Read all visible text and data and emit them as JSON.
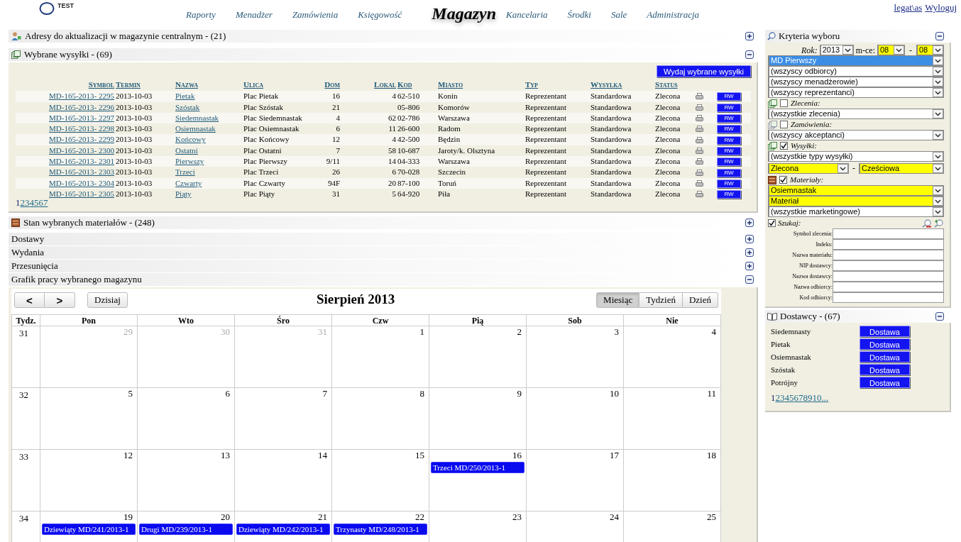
{
  "header": {
    "logo": "TEST",
    "nav": [
      {
        "label": "Raporty",
        "selected": false
      },
      {
        "label": "Menadżer",
        "selected": false
      },
      {
        "label": "Zamówienia",
        "selected": false
      },
      {
        "label": "Księgowość",
        "selected": false
      },
      {
        "label": "Magazyn",
        "selected": true
      },
      {
        "label": "Kancelaria",
        "selected": false
      },
      {
        "label": "Środki",
        "selected": false
      },
      {
        "label": "Sale",
        "selected": false
      },
      {
        "label": "Administracja",
        "selected": false
      }
    ],
    "user": "legat\\as",
    "logout": "Wyloguj"
  },
  "addresses_panel": {
    "title": "Adresy do aktualizacji w magazynie centralnym - (21)",
    "expanded": false
  },
  "shipments_panel": {
    "title": "Wybrane wysyłki - (69)",
    "expanded": true,
    "issue_button": "Wydaj wybrane wysyłki",
    "columns": [
      "Symbol",
      "Termin",
      "Nazwa",
      "Ulica",
      "Dom",
      "Lokal",
      "Kod",
      "Miasto",
      "Typ",
      "Wysylka",
      "Status"
    ],
    "rows": [
      {
        "symbol": "MD-165-2013- 2295",
        "termin": "2013-10-03",
        "nazwa": "Pietak",
        "ulica": "Plac Pietak",
        "dom": "16",
        "lokal": "4",
        "kod": "62-510",
        "miasto": "Konin",
        "typ": "Reprezentant",
        "wysylka": "Standardowa",
        "status": "Zlecona",
        "action": "RW"
      },
      {
        "symbol": "MD-165-2013- 2296",
        "termin": "2013-10-03",
        "nazwa": "Szóstak",
        "ulica": "Plac Szóstak",
        "dom": "21",
        "kod": "05-806",
        "miasto": "Komorów",
        "typ": "Reprezentant",
        "wysylka": "Standardowa",
        "status": "Zlecona",
        "action": "RW"
      },
      {
        "symbol": "MD-165-2013- 2297",
        "termin": "2013-10-03",
        "nazwa": "Siedemnastak",
        "ulica": "Plac Siedemnastak",
        "dom": "4",
        "lokal": "62",
        "kod": "02-786",
        "miasto": "Warszawa",
        "typ": "Reprezentant",
        "wysylka": "Standardowa",
        "status": "Zlecona",
        "action": "RW"
      },
      {
        "symbol": "MD-165-2013- 2298",
        "termin": "2013-10-03",
        "nazwa": "Osiemnastak",
        "ulica": "Plac Osiemnastak",
        "dom": "6",
        "lokal": "11",
        "kod": "26-600",
        "miasto": "Radom",
        "typ": "Reprezentant",
        "wysylka": "Standardowa",
        "status": "Zlecona",
        "action": "RW"
      },
      {
        "symbol": "MD-165-2013- 2299",
        "termin": "2013-10-03",
        "nazwa": "Końcowy",
        "ulica": "Plac Końcowy",
        "dom": "12",
        "lokal": "4",
        "kod": "42-500",
        "miasto": "Będzin",
        "typ": "Reprezentant",
        "wysylka": "Standardowa",
        "status": "Zlecona",
        "action": "RW"
      },
      {
        "symbol": "MD-165-2013- 2300",
        "termin": "2013-10-03",
        "nazwa": "Ostatni",
        "ulica": "Plac Ostatni",
        "dom": "7",
        "lokal": "58",
        "kod": "10-687",
        "miasto": "Jaroty/k. Olsztyna",
        "typ": "Reprezentant",
        "wysylka": "Standardowa",
        "status": "Zlecona",
        "action": "RW"
      },
      {
        "symbol": "MD-165-2013- 2301",
        "termin": "2013-10-03",
        "nazwa": "Pierwszy",
        "ulica": "Plac Pierwszy",
        "dom": "9/11",
        "lokal": "14",
        "kod": "04-333",
        "miasto": "Warszawa",
        "typ": "Reprezentant",
        "wysylka": "Standardowa",
        "status": "Zlecona",
        "action": "RW"
      },
      {
        "symbol": "MD-165-2013- 2303",
        "termin": "2013-10-03",
        "nazwa": "Trzeci",
        "ulica": "Plac Trzeci",
        "dom": "26",
        "lokal": "6",
        "kod": "70-028",
        "miasto": "Szczecin",
        "typ": "Reprezentant",
        "wysylka": "Standardowa",
        "status": "Zlecona",
        "action": "RW"
      },
      {
        "symbol": "MD-165-2013- 2304",
        "termin": "2013-10-03",
        "nazwa": "Czwarty",
        "ulica": "Plac Czwarty",
        "dom": "94F",
        "lokal": "20",
        "kod": "87-100",
        "miasto": "Toruń",
        "typ": "Reprezentant",
        "wysylka": "Standardowa",
        "status": "Zlecona",
        "action": "RW"
      },
      {
        "symbol": "MD-165-2013- 2305",
        "termin": "2013-10-03",
        "nazwa": "Piąty",
        "ulica": "Plac Piąty",
        "dom": "31",
        "lokal": "5",
        "kod": "64-920",
        "miasto": "Piła",
        "typ": "Reprezentant",
        "wysylka": "Standardowa",
        "status": "Zlecona",
        "action": "RW"
      }
    ],
    "pages": [
      {
        "label": "1",
        "selected": true
      },
      {
        "label": "2",
        "selected": false
      },
      {
        "label": "3",
        "selected": false
      },
      {
        "label": "4",
        "selected": false
      },
      {
        "label": "5",
        "selected": false
      },
      {
        "label": "6",
        "selected": false
      },
      {
        "label": "7",
        "selected": false
      }
    ]
  },
  "materials_panel": {
    "title": "Stan wybranych materiałów - (248)",
    "expanded": false
  },
  "panels": [
    {
      "title": "Dostawy",
      "expanded": false
    },
    {
      "title": "Wydania",
      "expanded": false
    },
    {
      "title": "Przesunięcia",
      "expanded": false
    },
    {
      "title": "Grafik pracy wybranego magazynu",
      "expanded": true
    }
  ],
  "calendar": {
    "prev": "<",
    "next": ">",
    "today": "Dzisiaj",
    "title": "Sierpień 2013",
    "views": [
      {
        "label": "Miesiąc",
        "selected": true
      },
      {
        "label": "Tydzień",
        "selected": false
      },
      {
        "label": "Dzień",
        "selected": false
      }
    ],
    "week_header": "Tydz.",
    "day_names": [
      "Pon",
      "Wto",
      "Śro",
      "Czw",
      "Pią",
      "Sob",
      "Nie"
    ],
    "weeks": [
      {
        "number": "31",
        "days": [
          {
            "date": "29",
            "other_month": true
          },
          {
            "date": "30",
            "other_month": true
          },
          {
            "date": "31",
            "other_month": true
          },
          {
            "date": "1",
            "other_month": false
          },
          {
            "date": "2",
            "other_month": false
          },
          {
            "date": "3",
            "other_month": false
          },
          {
            "date": "4",
            "other_month": false
          }
        ]
      },
      {
        "number": "32",
        "days": [
          {
            "date": "5",
            "other_month": false
          },
          {
            "date": "6",
            "other_month": false
          },
          {
            "date": "7",
            "other_month": false
          },
          {
            "date": "8",
            "other_month": false
          },
          {
            "date": "9",
            "other_month": false
          },
          {
            "date": "10",
            "other_month": false
          },
          {
            "date": "11",
            "other_month": false
          }
        ]
      },
      {
        "number": "33",
        "days": [
          {
            "date": "12",
            "other_month": false
          },
          {
            "date": "13",
            "other_month": false
          },
          {
            "date": "14",
            "other_month": false
          },
          {
            "date": "15",
            "other_month": false
          },
          {
            "date": "16",
            "other_month": false,
            "events": [
              "Trzeci MD/250/2013-1"
            ]
          },
          {
            "date": "17",
            "other_month": false
          },
          {
            "date": "18",
            "other_month": false
          }
        ]
      },
      {
        "number": "34",
        "days": [
          {
            "date": "19",
            "other_month": false,
            "events": [
              "Dziewiąty MD/241/2013-1"
            ]
          },
          {
            "date": "20",
            "other_month": false,
            "events": [
              "Drugi MD/239/2013-1"
            ]
          },
          {
            "date": "21",
            "other_month": false,
            "events": [
              "Dziewiąty MD/242/2013-1"
            ]
          },
          {
            "date": "22",
            "other_month": false,
            "events": [
              "Trzynasty MD/248/2013-1"
            ]
          },
          {
            "date": "23",
            "other_month": false
          },
          {
            "date": "24",
            "other_month": false
          },
          {
            "date": "25",
            "other_month": false
          }
        ]
      }
    ]
  },
  "criteria": {
    "title": "Kryteria wyboru",
    "expanded": true,
    "year_label": "Rok:",
    "year": "2013",
    "month_label": "m-ce:",
    "month_from": "08",
    "month_separator": "-",
    "month_to": "08",
    "months_highlighted": true,
    "rows": [
      {
        "kind": "select",
        "value": "MD Pierwszy",
        "focused": true
      },
      {
        "kind": "select",
        "value": "(wszyscy odbiorcy)",
        "focused": false,
        "highlighted": false
      },
      {
        "kind": "select",
        "value": "(wszyscy menadżerowie)",
        "focused": false,
        "highlighted": false
      },
      {
        "kind": "select",
        "value": "(wszyscy reprezentanci)",
        "focused": false,
        "highlighted": false
      },
      {
        "kind": "group",
        "label": "Zlecenia:",
        "checked": false
      },
      {
        "kind": "select",
        "value": "(wszystkie zlecenia)",
        "focused": false,
        "highlighted": false
      },
      {
        "kind": "group",
        "label": "Zamówienia:",
        "checked": false
      },
      {
        "kind": "select",
        "value": "(wszyscy akceptanci)",
        "focused": false,
        "highlighted": false
      },
      {
        "kind": "group",
        "label": "Wysyłki:",
        "checked": true
      },
      {
        "kind": "select",
        "value": "(wszystkie typy wysyłki)",
        "focused": false,
        "highlighted": false
      },
      {
        "kind": "range",
        "from": "Zlecona",
        "separator": "-",
        "to": "Cześciowa",
        "highlighted": true
      },
      {
        "kind": "group",
        "label": "Materiały:",
        "checked": true
      },
      {
        "kind": "select",
        "value": "Osiemnastak",
        "focused": false,
        "highlighted": true
      },
      {
        "kind": "select",
        "value": "Materiał",
        "focused": false,
        "highlighted": true
      },
      {
        "kind": "select",
        "value": "(wszystkie marketingowe)",
        "focused": false,
        "highlighted": false
      }
    ],
    "search": {
      "label": "Szukaj:",
      "checked": true,
      "fields": [
        "Symbol zlecenia:",
        "Indeks:",
        "Nazwa materiału:",
        "NIP dostawcy:",
        "Nazwa dostawcy:",
        "Nazwa odbiorcy:",
        "Kod odbiorcy:"
      ]
    }
  },
  "suppliers": {
    "title": "Dostawcy - (67)",
    "expanded": true,
    "rows": [
      {
        "name": "Siedemnasty",
        "button": "Dostawa"
      },
      {
        "name": "Pietak",
        "button": "Dostawa"
      },
      {
        "name": "Osiemnastak",
        "button": "Dostawa"
      },
      {
        "name": "Szóstak",
        "button": "Dostawa"
      },
      {
        "name": "Potrójny",
        "button": "Dostawa"
      }
    ],
    "pages": [
      {
        "label": "1",
        "selected": true
      },
      {
        "label": "2",
        "selected": false
      },
      {
        "label": "3",
        "selected": false
      },
      {
        "label": "4",
        "selected": false
      },
      {
        "label": "5",
        "selected": false
      },
      {
        "label": "6",
        "selected": false
      },
      {
        "label": "7",
        "selected": false
      },
      {
        "label": "8",
        "selected": false
      },
      {
        "label": "9",
        "selected": false
      },
      {
        "label": "10",
        "selected": false
      },
      {
        "label": "...",
        "selected": false
      }
    ]
  }
}
